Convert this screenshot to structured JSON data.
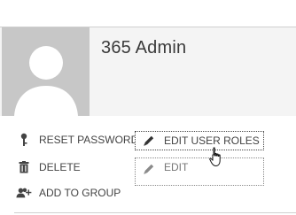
{
  "user": {
    "display_name": "365 Admin",
    "avatar_icon": "person-silhouette-icon"
  },
  "actions": {
    "reset_password": {
      "label": "RESET PASSWORD",
      "icon": "key-icon"
    },
    "delete": {
      "label": "DELETE",
      "icon": "trash-icon"
    },
    "add_to_group": {
      "label": "ADD TO GROUP",
      "icon": "add-people-icon"
    },
    "edit_user_roles": {
      "label": "EDIT USER ROLES",
      "icon": "pencil-icon"
    },
    "edit": {
      "label": "EDIT",
      "icon": "pencil-icon"
    }
  },
  "cursor": {
    "icon": "hand-pointer-icon"
  },
  "colors": {
    "header_background": "#f4f4f4",
    "avatar_background": "#c7c7c7",
    "text": "#444444",
    "disabled_text": "#777777"
  }
}
